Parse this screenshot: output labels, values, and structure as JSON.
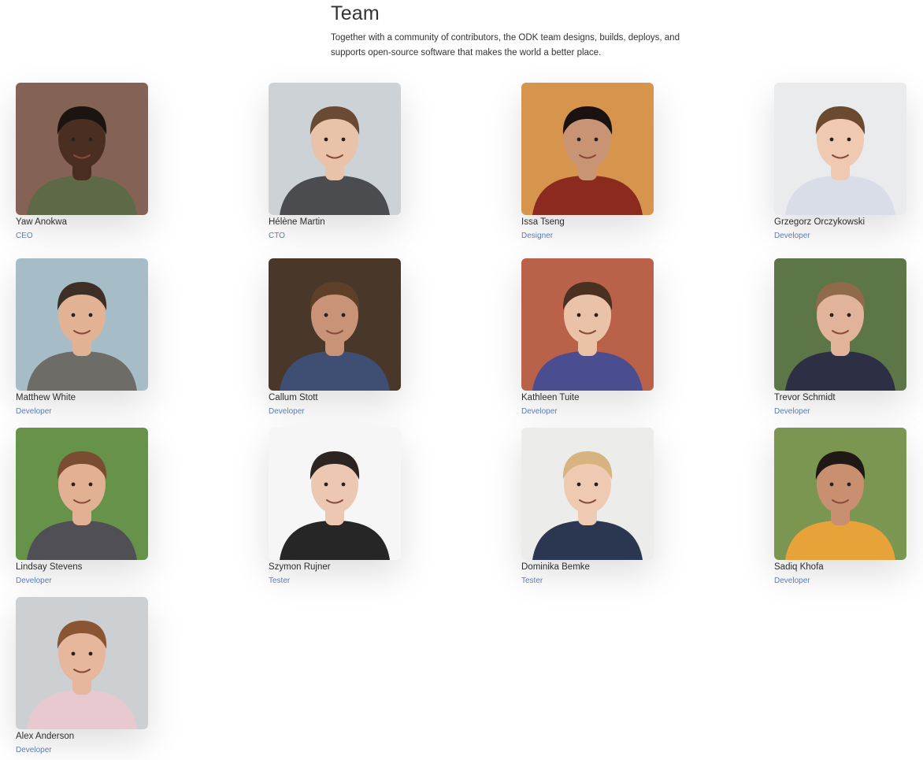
{
  "header": {
    "title": "Team",
    "intro": "Together with a community of contributors, the ODK team designs, builds, deploys, and supports open-source software that makes the world a better place."
  },
  "members": [
    {
      "name": "Yaw Anokwa",
      "role": "CEO",
      "bg": "#7a5548",
      "skin": "#4a2e22",
      "hair": "#1c1410",
      "shirt": "#5e6a47"
    },
    {
      "name": "Hélène Martin",
      "role": "CTO",
      "bg": "#c9cfd3",
      "skin": "#e8c3aa",
      "hair": "#6a4a33",
      "shirt": "#4b4c50"
    },
    {
      "name": "Issa Tseng",
      "role": "Designer",
      "bg": "#d48b3e",
      "skin": "#c99473",
      "hair": "#1a1210",
      "shirt": "#8b2b20"
    },
    {
      "name": "Grzegorz Orczykowski",
      "role": "Developer",
      "bg": "#e9eaec",
      "skin": "#efc9b1",
      "hair": "#6b4a30",
      "shirt": "#d9dde8"
    },
    {
      "name": "Matthew White",
      "role": "Developer",
      "bg": "#9fb8c4",
      "skin": "#e1b294",
      "hair": "#3d2f25",
      "shirt": "#6d6c66"
    },
    {
      "name": "Callum Stott",
      "role": "Developer",
      "bg": "#3a2618",
      "skin": "#c99377",
      "hair": "#5e3f28",
      "shirt": "#3f4f74"
    },
    {
      "name": "Kathleen Tuite",
      "role": "Developer",
      "bg": "#b5553a",
      "skin": "#eac2a7",
      "hair": "#4a3020",
      "shirt": "#4a4d8f"
    },
    {
      "name": "Trevor Schmidt",
      "role": "Developer",
      "bg": "#4f6b39",
      "skin": "#e0b39a",
      "hair": "#8f6b4b",
      "shirt": "#2d2f44"
    },
    {
      "name": "Lindsay Stevens",
      "role": "Developer",
      "bg": "#5a8a3a",
      "skin": "#e2b194",
      "hair": "#7a4d31",
      "shirt": "#4f4f55"
    },
    {
      "name": "Szymon Rujner",
      "role": "Tester",
      "bg": "#f6f6f6",
      "skin": "#ecc7b1",
      "hair": "#2c2420",
      "shirt": "#262626"
    },
    {
      "name": "Dominika Bemke",
      "role": "Tester",
      "bg": "#ebebea",
      "skin": "#efcab2",
      "hair": "#d7b47f",
      "shirt": "#2b3650"
    },
    {
      "name": "Sadiq Khofa",
      "role": "Developer",
      "bg": "#6f8e42",
      "skin": "#c89070",
      "hair": "#201814",
      "shirt": "#e7a23a"
    },
    {
      "name": "Alex Anderson",
      "role": "Developer",
      "bg": "#c9ccd0",
      "skin": "#e6b79d",
      "hair": "#8a5532",
      "shirt": "#e7c9cf"
    }
  ]
}
